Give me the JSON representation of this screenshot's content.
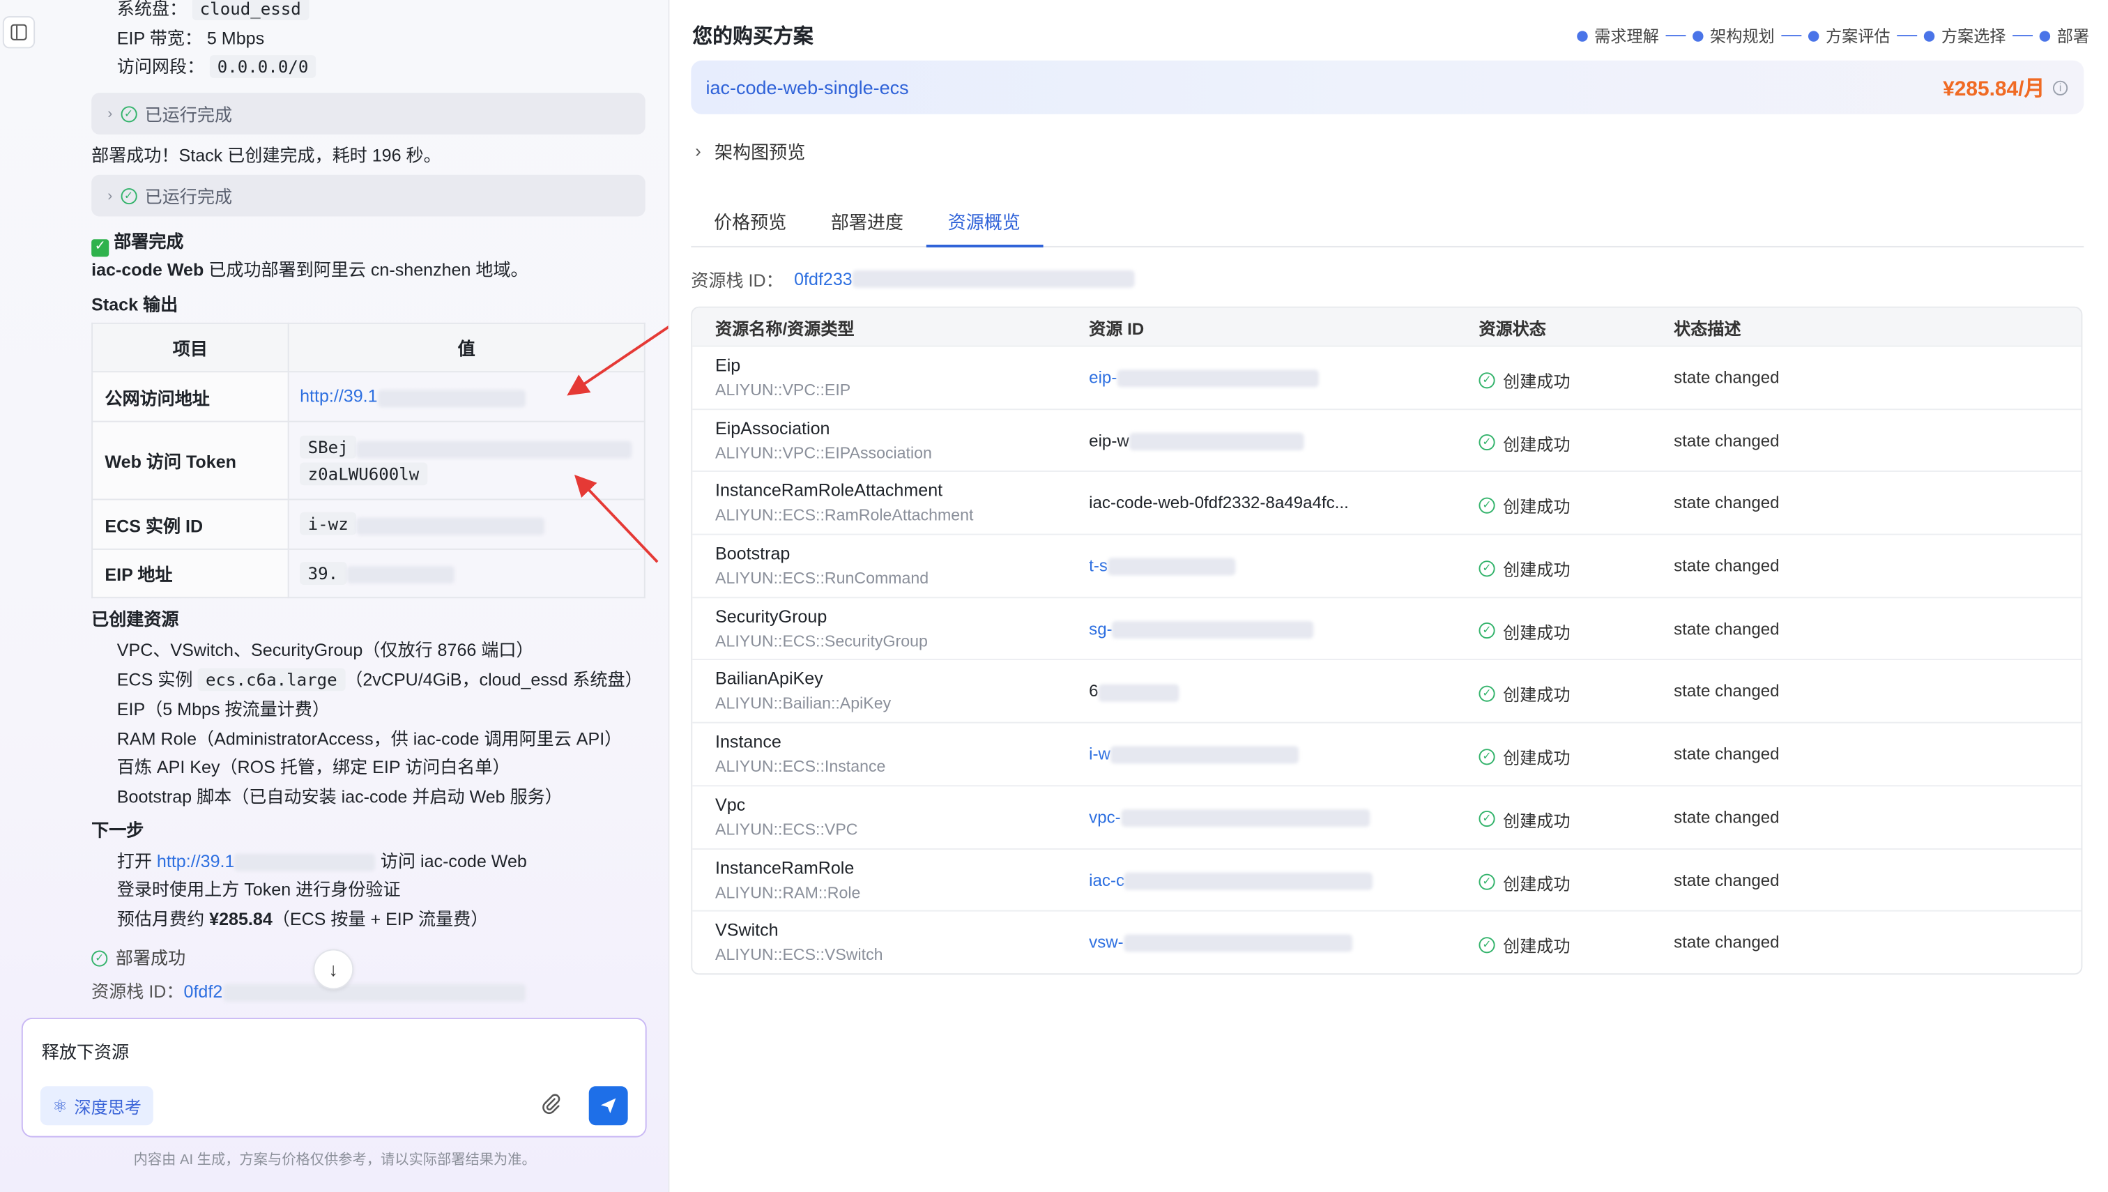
{
  "left": {
    "sysdisk_label": "系统盘：",
    "sysdisk_value": "cloud_essd",
    "eip_bw": "EIP 带宽： 5 Mbps",
    "access_label": "访问网段：",
    "access_value": "0.0.0.0/0",
    "run_done": "已运行完成",
    "deploy_msg": "部署成功！Stack 已创建完成，耗时 196 秒。",
    "deploy_done_title": "部署完成",
    "deploy_summary_bold": "iac-code Web",
    "deploy_summary_rest": " 已成功部署到阿里云 cn-shenzhen 地域。",
    "stack_output_title": "Stack 输出",
    "output_table": {
      "col_item": "项目",
      "col_value": "值",
      "rows": [
        {
          "key": "公网访问地址",
          "value": "http://39.1"
        },
        {
          "key": "Web 访问 Token",
          "value": "SBej",
          "value2": "z0aLWU600lw"
        },
        {
          "key": "ECS 实例 ID",
          "value": "i-wz"
        },
        {
          "key": "EIP 地址",
          "value": "39."
        }
      ]
    },
    "created_title": "已创建资源",
    "created_items": [
      "VPC、VSwitch、SecurityGroup（仅放行 8766 端口）",
      "ECS 实例 ",
      "EIP（5 Mbps 按流量计费）",
      "RAM Role（AdministratorAccess，供 iac-code 调用阿里云 API）",
      "百炼 API Key（ROS 托管，绑定 EIP 访问白名单）",
      "Bootstrap 脚本（已自动安装 iac-code 并启动 Web 服务）"
    ],
    "ecs_type": "ecs.c6a.large",
    "ecs_type_rest": "（2vCPU/4GiB，cloud_essd 系统盘）",
    "next_title": "下一步",
    "next_open": "打开 ",
    "next_link": "http://39.1",
    "next_open_rest": " 访问 iac-code Web",
    "next_login": "登录时使用上方 Token 进行身份验证",
    "next_cost_prefix": "预估月费约 ",
    "next_cost_value": "¥285.84",
    "next_cost_rest": "（ECS 按量 + EIP 流量费）",
    "deploy_success": "部署成功",
    "stack_id_label": "资源栈 ID：",
    "stack_id_value": "0fdf2"
  },
  "composer": {
    "input_value": "释放下资源",
    "deep_think": "深度思考",
    "disclaimer": "内容由 AI 生成，方案与价格仅供参考，请以实际部署结果为准。"
  },
  "right": {
    "title": "您的购买方案",
    "steps": [
      "需求理解",
      "架构规划",
      "方案评估",
      "方案选择",
      "部署"
    ],
    "plan_name": "iac-code-web-single-ecs",
    "price": "¥285.84/月",
    "arch_preview": "架构图预览",
    "tabs": [
      "价格预览",
      "部署进度",
      "资源概览"
    ],
    "stack_id_label": "资源栈 ID：",
    "stack_id_value": "0fdf233",
    "table_headers": [
      "资源名称/资源类型",
      "资源 ID",
      "资源状态",
      "状态描述"
    ],
    "resources": [
      {
        "name": "Eip",
        "type": "ALIYUN::VPC::EIP",
        "id": "eip-",
        "status": "创建成功",
        "desc": "state changed"
      },
      {
        "name": "EipAssociation",
        "type": "ALIYUN::VPC::EIPAssociation",
        "id": "eip-w",
        "status": "创建成功",
        "desc": "state changed"
      },
      {
        "name": "InstanceRamRoleAttachment",
        "type": "ALIYUN::ECS::RamRoleAttachment",
        "id": "iac-code-web-0fdf2332-8a49a4fc...",
        "status": "创建成功",
        "desc": "state changed"
      },
      {
        "name": "Bootstrap",
        "type": "ALIYUN::ECS::RunCommand",
        "id": "t-s",
        "status": "创建成功",
        "desc": "state changed"
      },
      {
        "name": "SecurityGroup",
        "type": "ALIYUN::ECS::SecurityGroup",
        "id": "sg-",
        "status": "创建成功",
        "desc": "state changed"
      },
      {
        "name": "BailianApiKey",
        "type": "ALIYUN::Bailian::ApiKey",
        "id": "6",
        "status": "创建成功",
        "desc": "state changed"
      },
      {
        "name": "Instance",
        "type": "ALIYUN::ECS::Instance",
        "id": "i-w",
        "status": "创建成功",
        "desc": "state changed"
      },
      {
        "name": "Vpc",
        "type": "ALIYUN::ECS::VPC",
        "id": "vpc-",
        "status": "创建成功",
        "desc": "state changed"
      },
      {
        "name": "InstanceRamRole",
        "type": "ALIYUN::RAM::Role",
        "id": "iac-c",
        "status": "创建成功",
        "desc": "state changed"
      },
      {
        "name": "VSwitch",
        "type": "ALIYUN::ECS::VSwitch",
        "id": "vsw-",
        "status": "创建成功",
        "desc": "state changed"
      }
    ]
  },
  "colors": {
    "accent": "#2f62d8",
    "price": "#f06a23",
    "success": "#33b36b",
    "arrow": "#e53935"
  }
}
